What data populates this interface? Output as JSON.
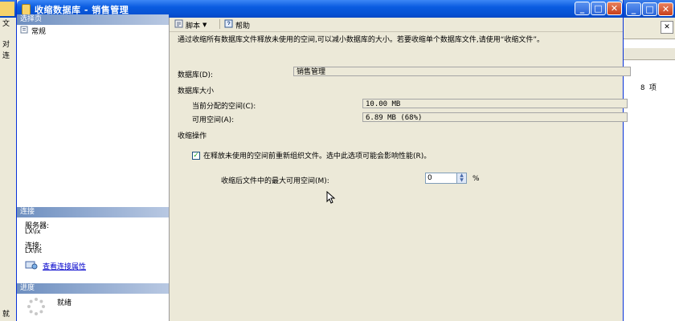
{
  "background_app": {
    "left_strip_items": [
      "文",
      "对",
      "连"
    ],
    "right_count": "8 项",
    "status_left": "就"
  },
  "dialog": {
    "title": "收缩数据库 - 销售管理",
    "controls": {
      "minimize": "_",
      "maximize": "□",
      "close": "✕"
    }
  },
  "sidebar": {
    "select_page_header": "选择页",
    "pages": [
      {
        "label": "常规",
        "icon": "page-icon"
      }
    ],
    "connection_header": "连接",
    "server_label": "服务器:",
    "server_value": "LX\\lx",
    "connection_label": "连接:",
    "connection_value": "LX\\ht",
    "view_properties_link": "查看连接属性",
    "progress_header": "进度",
    "progress_status": "就绪"
  },
  "toolbar": {
    "script_label": "脚本",
    "help_label": "帮助"
  },
  "main": {
    "description": "通过收缩所有数据库文件释放未使用的空间,可以减小数据库的大小。若要收缩单个数据库文件,请使用“收缩文件”。",
    "database_label": "数据库(D):",
    "database_value": "销售管理",
    "size_section": "数据库大小",
    "allocated_label": "当前分配的空间(C):",
    "allocated_value": "10.00 MB",
    "free_label": "可用空间(A):",
    "free_value": "6.89 MB (68%)",
    "shrink_section": "收缩操作",
    "reorganize_label": "在释放未使用的空间前重新组织文件。选中此选项可能会影响性能(R)。",
    "reorganize_checked": true,
    "max_free_label": "收缩后文件中的最大可用空间(M):",
    "max_free_value": "0",
    "percent_unit": "%"
  }
}
